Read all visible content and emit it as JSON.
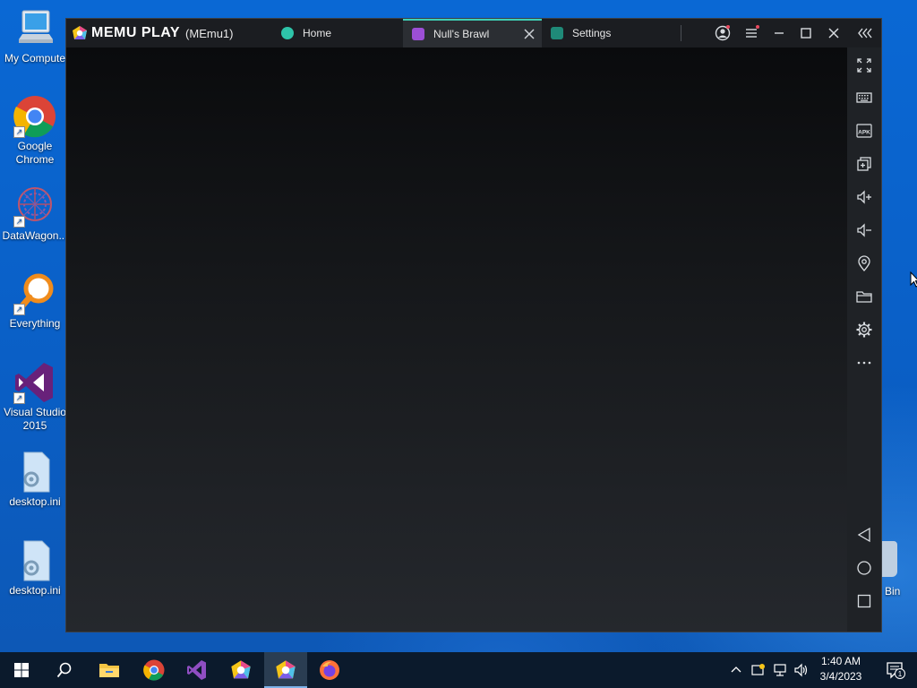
{
  "desktop": {
    "icons": [
      {
        "label": "My Compute",
        "icon": "computer-icon"
      },
      {
        "label": "Google Chrome",
        "icon": "chrome-icon"
      },
      {
        "label": "DataWagon...",
        "icon": "datawagon-icon"
      },
      {
        "label": "Everything",
        "icon": "everything-search-icon"
      },
      {
        "label": "Visual Studio 2015",
        "icon": "visual-studio-icon"
      },
      {
        "label": "desktop.ini",
        "icon": "settings-file-icon"
      },
      {
        "label": "desktop.ini",
        "icon": "settings-file-icon"
      }
    ],
    "recycle_bin_label": "Bin"
  },
  "emulator": {
    "brand": "MEMU PLAY",
    "instance": "(MEmu1)",
    "accent_color": "#3fd1b6",
    "tabs": [
      {
        "label": "Home",
        "icon": "home-app-icon",
        "active": false
      },
      {
        "label": "Null's Brawl",
        "icon": "nulls-brawl-icon",
        "active": true
      },
      {
        "label": "Settings",
        "icon": "settings-app-icon",
        "active": false
      }
    ],
    "title_controls": [
      "account-icon",
      "menu-icon",
      "minimize-icon",
      "maximize-icon",
      "close-icon",
      "collapse-sidebar-icon"
    ],
    "sidebar_tools": [
      {
        "name": "fullscreen-icon"
      },
      {
        "name": "keyboard-icon"
      },
      {
        "name": "apk-install-icon",
        "text": "APK"
      },
      {
        "name": "multi-instance-icon"
      },
      {
        "name": "volume-up-icon"
      },
      {
        "name": "volume-down-icon"
      },
      {
        "name": "location-icon"
      },
      {
        "name": "folder-icon"
      },
      {
        "name": "settings-gear-icon"
      },
      {
        "name": "more-icon"
      }
    ],
    "android_nav": [
      "back-icon",
      "home-icon",
      "recents-icon"
    ]
  },
  "taskbar": {
    "items": [
      "start-icon",
      "search-icon",
      "file-explorer-icon",
      "chrome-icon",
      "visual-studio-icon",
      "memu-multi-icon",
      "memu-icon",
      "firefox-icon"
    ],
    "active_item": "memu-icon",
    "tray_icons": [
      "show-hidden-icons-icon",
      "network-share-icon",
      "network-icon",
      "volume-icon"
    ],
    "time": "1:40 AM",
    "date": "3/4/2023",
    "notification_count": "1"
  }
}
